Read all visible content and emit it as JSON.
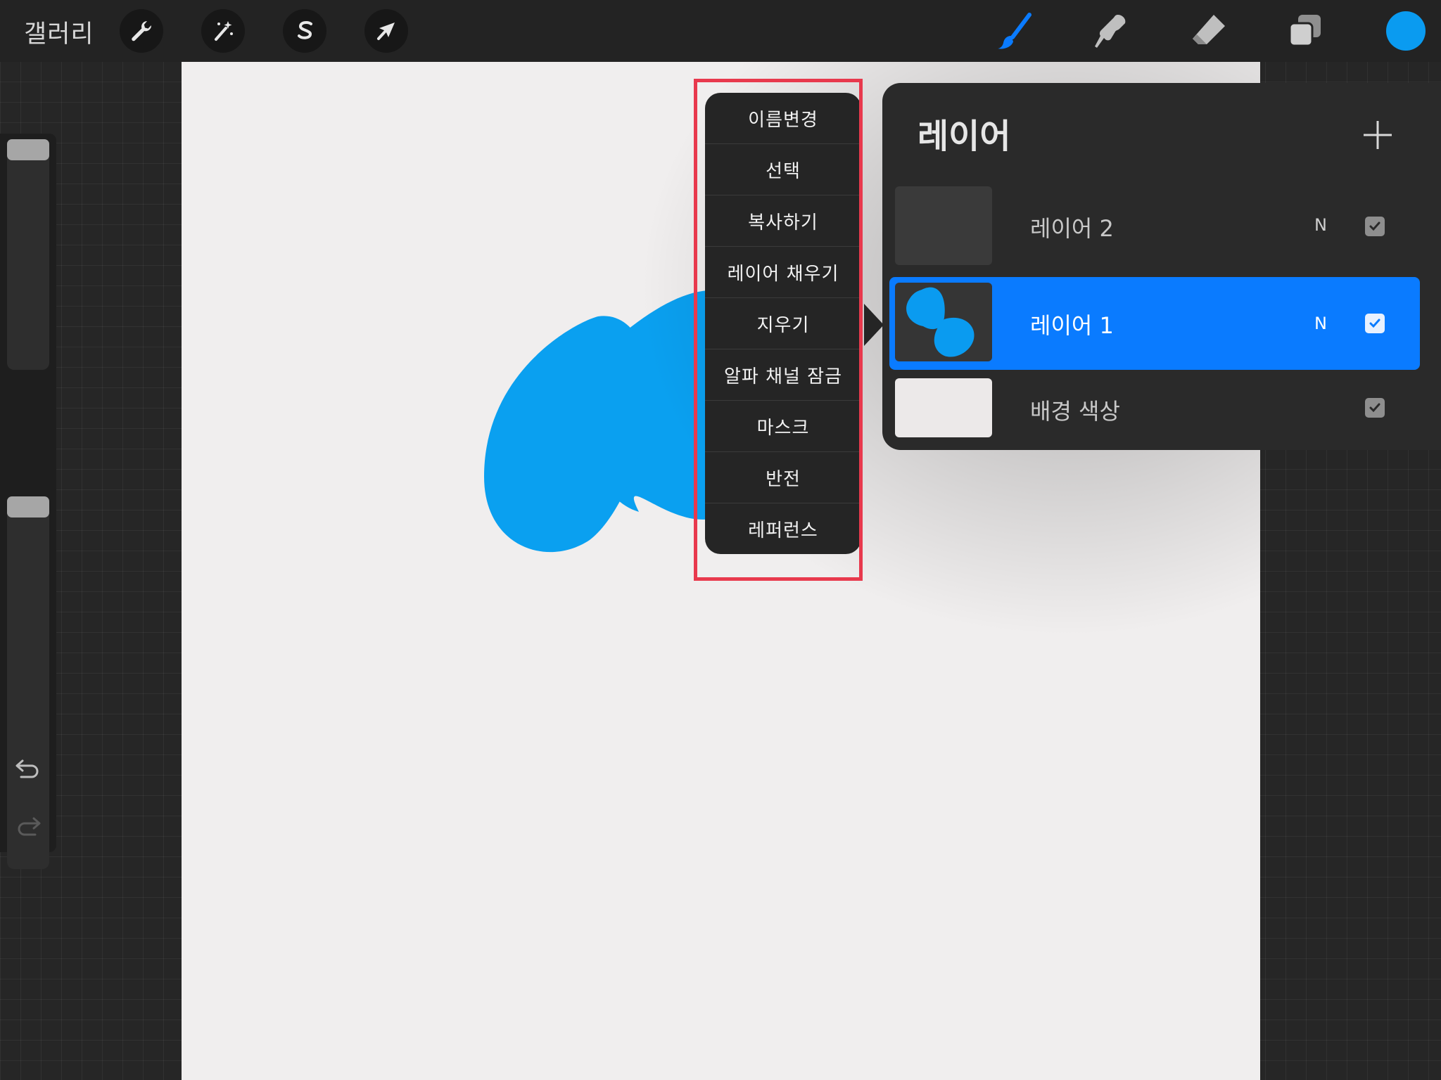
{
  "topbar": {
    "gallery_label": "갤러리",
    "left_tools": [
      "wrench-icon",
      "magic-wand-icon",
      "selection-s-icon",
      "transform-arrow-icon"
    ],
    "right_tools": [
      "brush-icon",
      "smudge-icon",
      "eraser-icon",
      "layers-icon"
    ],
    "current_color": "#0a9bf0",
    "active_tool_color": "#0a7bff"
  },
  "sidebar": {
    "brush_size_level": 1.0,
    "opacity_level": 1.0
  },
  "context_menu": {
    "items": [
      "이름변경",
      "선택",
      "복사하기",
      "레이어 채우기",
      "지우기",
      "알파 채널 잠금",
      "마스크",
      "반전",
      "레퍼런스"
    ],
    "highlight_color": "#e8394d"
  },
  "layers_panel": {
    "title": "레이어",
    "layers": [
      {
        "name": "레이어 2",
        "blend": "N",
        "visible": true,
        "selected": false
      },
      {
        "name": "레이어 1",
        "blend": "N",
        "visible": true,
        "selected": true
      },
      {
        "name": "배경 색상",
        "blend": "",
        "visible": true,
        "selected": false
      }
    ],
    "selected_color": "#0a7bff"
  },
  "canvas": {
    "background": "#f0eeee",
    "stroke_color": "#0aa0f0"
  }
}
